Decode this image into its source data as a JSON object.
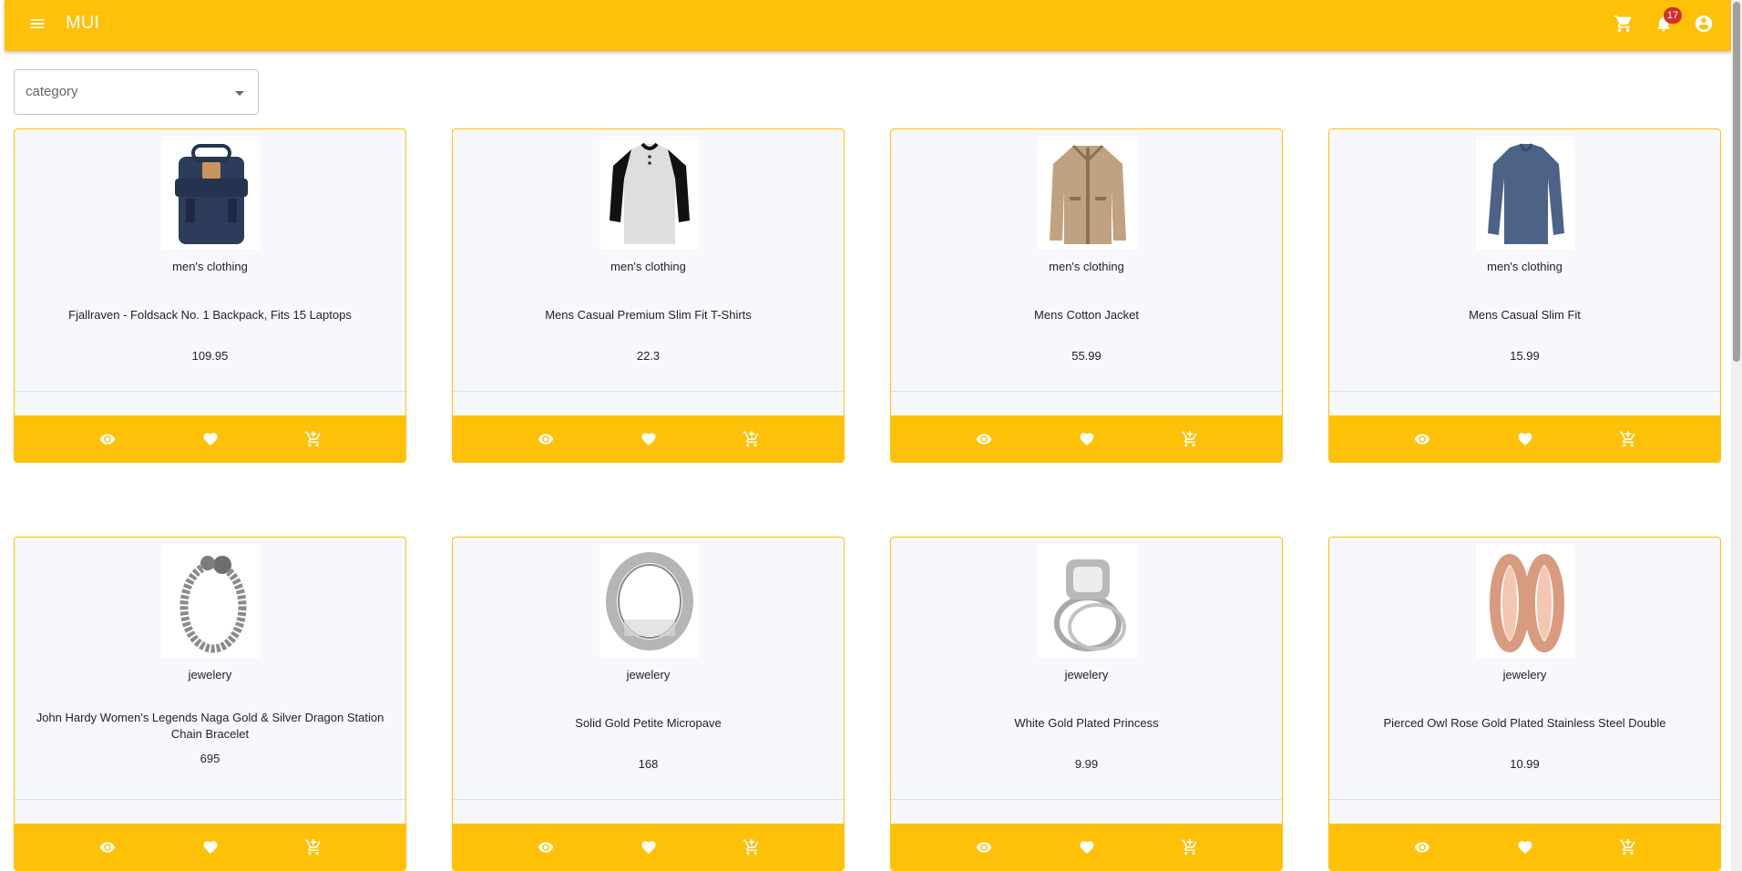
{
  "appbar": {
    "brand": "MUI",
    "notification_count": "17",
    "icons": [
      "menu-icon",
      "cart-icon",
      "notification-icon",
      "account-icon"
    ]
  },
  "filter": {
    "category_label": "category"
  },
  "colors": {
    "accent": "#ffc107",
    "card_bg": "#f6f8fb",
    "badge": "#d32f2f"
  },
  "products": [
    {
      "category": "men's clothing",
      "title": "Fjallraven - Foldsack No. 1 Backpack, Fits 15 Laptops",
      "price": "109.95",
      "image": "backpack"
    },
    {
      "category": "men's clothing",
      "title": "Mens Casual Premium Slim Fit T-Shirts",
      "price": "22.3",
      "image": "tshirt"
    },
    {
      "category": "men's clothing",
      "title": "Mens Cotton Jacket",
      "price": "55.99",
      "image": "jacket"
    },
    {
      "category": "men's clothing",
      "title": "Mens Casual Slim Fit",
      "price": "15.99",
      "image": "longsleeve"
    },
    {
      "category": "jewelery",
      "title": "John Hardy Women's Legends Naga Gold & Silver Dragon Station Chain Bracelet",
      "price": "695",
      "image": "bracelet"
    },
    {
      "category": "jewelery",
      "title": "Solid Gold Petite Micropave",
      "price": "168",
      "image": "ring"
    },
    {
      "category": "jewelery",
      "title": "White Gold Plated Princess",
      "price": "9.99",
      "image": "diamond-ring"
    },
    {
      "category": "jewelery",
      "title": "Pierced Owl Rose Gold Plated Stainless Steel Double",
      "price": "10.99",
      "image": "earrings"
    }
  ]
}
